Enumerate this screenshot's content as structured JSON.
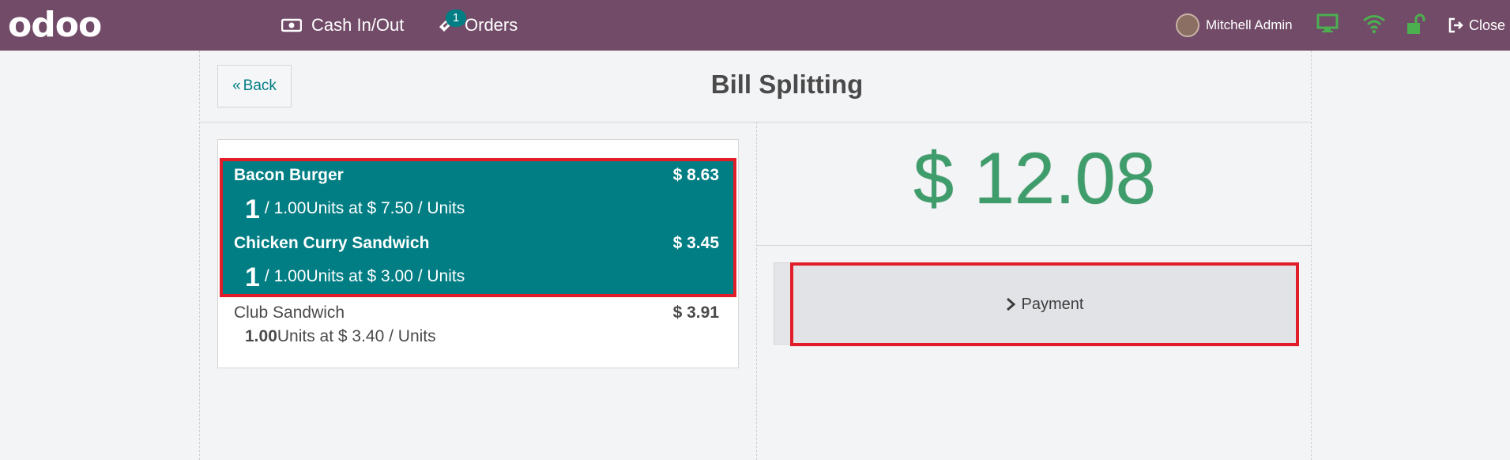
{
  "navbar": {
    "logo": "odoo",
    "cash_label": "Cash In/Out",
    "orders_label": "Orders",
    "orders_badge": "1",
    "user_name": "Mitchell Admin",
    "close_label": "Close",
    "colors": {
      "background": "#714b67",
      "badge": "#017e84",
      "status_green": "#4caf50"
    },
    "icons": [
      "money-icon",
      "ticket-icon",
      "monitor-icon",
      "wifi-icon",
      "lock-open-icon",
      "sign-out-icon"
    ]
  },
  "screen": {
    "back_label": "Back",
    "title": "Bill Splitting"
  },
  "order_lines": [
    {
      "name": "Bacon Burger",
      "price": "$ 8.63",
      "qty_selected": "1",
      "info": "/ 1.00Units at $ 7.50 / Units",
      "selected": true
    },
    {
      "name": "Chicken Curry Sandwich",
      "price": "$ 3.45",
      "qty_selected": "1",
      "info": "/ 1.00Units at $ 3.00 / Units",
      "selected": true
    },
    {
      "name": "Club Sandwich",
      "price": "$ 3.91",
      "qty": "1.00",
      "info": "Units at $ 3.40 / Units",
      "selected": false
    }
  ],
  "total": "$ 12.08",
  "payment_label": "Payment",
  "colors": {
    "selected_bg": "#017e84",
    "highlight_border": "#e11d2a",
    "total": "#3f9c6b"
  }
}
